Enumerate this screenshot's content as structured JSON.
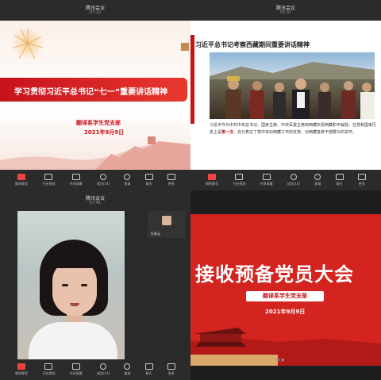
{
  "meeting": {
    "app_title": "腾讯会议",
    "q1_time": "07:10",
    "q2_time": "05:37",
    "q3_time": "07:41"
  },
  "toolbar": {
    "items": [
      {
        "label": "解除静音",
        "icon": "mic-off-icon"
      },
      {
        "label": "开启视频",
        "icon": "camera-icon"
      },
      {
        "label": "共享屏幕",
        "icon": "screen-share-icon"
      },
      {
        "label": "成员(14)",
        "icon": "members-icon"
      },
      {
        "label": "邀请",
        "icon": "invite-icon"
      },
      {
        "label": "聊天",
        "icon": "chat-icon"
      },
      {
        "label": "更多",
        "icon": "more-icon"
      }
    ]
  },
  "slide1": {
    "title": "学习贯彻习近平总书记“七一”重要讲话精神",
    "org": "翻译系学生党支部",
    "date": "2021年9月9日"
  },
  "slide2": {
    "title": "习近平总书记考察西藏期间重要讲话精神",
    "body_pre": "习近平作为中共中央总书记、国家主席、中央军委主席到西藏庆祝西藏和平解放，在党和国家历史上是",
    "body_highlight": "第一次",
    "body_post": "。充分表达了党中央对西藏工作的支持、对西藏各族干部群众的关怀。"
  },
  "video": {
    "participant_name": "杜鹃云"
  },
  "slide4": {
    "title": "接收预备党员大会",
    "org": "翻译系学生党支部",
    "date": "2021年9月9日"
  },
  "colors": {
    "party_red": "#c7121c",
    "toolbar_bg": "#2b2b2b"
  }
}
